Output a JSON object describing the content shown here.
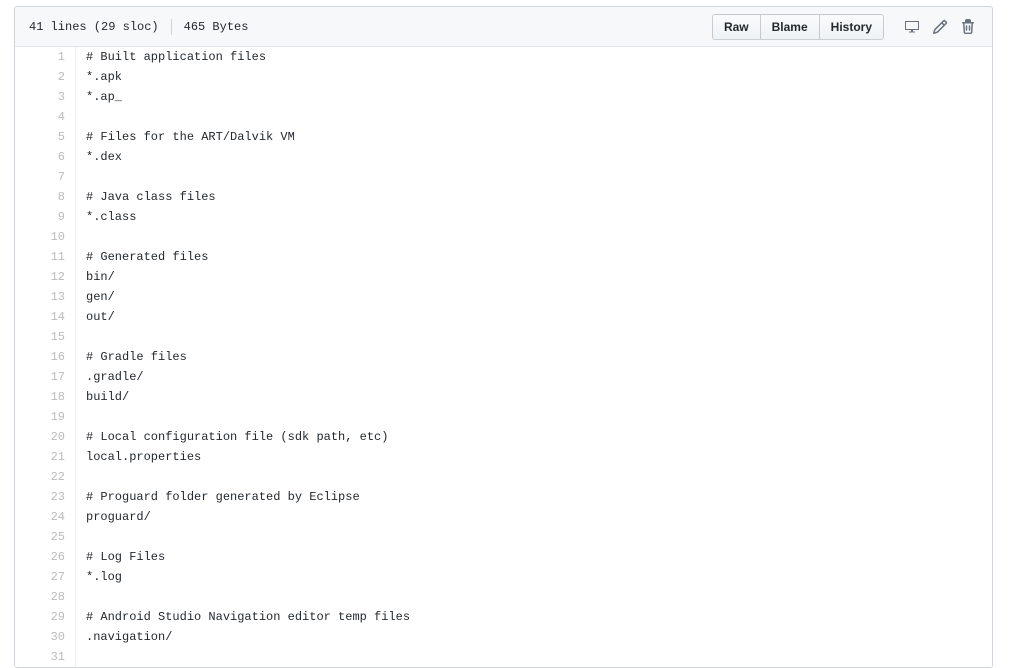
{
  "header": {
    "lines_label": "41 lines (29 sloc)",
    "size_label": "465 Bytes",
    "buttons": [
      {
        "label": "Raw",
        "name": "raw-button"
      },
      {
        "label": "Blame",
        "name": "blame-button"
      },
      {
        "label": "History",
        "name": "history-button"
      }
    ],
    "icons": [
      {
        "name": "desktop-icon",
        "title": "Open this file in GitHub Desktop"
      },
      {
        "name": "pencil-icon",
        "title": "Edit this file"
      },
      {
        "name": "trash-icon",
        "title": "Delete this file"
      }
    ]
  },
  "code": {
    "lines": [
      {
        "num": "1",
        "text": "# Built application files"
      },
      {
        "num": "2",
        "text": "*.apk"
      },
      {
        "num": "3",
        "text": "*.ap_"
      },
      {
        "num": "4",
        "text": ""
      },
      {
        "num": "5",
        "text": "# Files for the ART/Dalvik VM"
      },
      {
        "num": "6",
        "text": "*.dex"
      },
      {
        "num": "7",
        "text": ""
      },
      {
        "num": "8",
        "text": "# Java class files"
      },
      {
        "num": "9",
        "text": "*.class"
      },
      {
        "num": "10",
        "text": ""
      },
      {
        "num": "11",
        "text": "# Generated files"
      },
      {
        "num": "12",
        "text": "bin/"
      },
      {
        "num": "13",
        "text": "gen/"
      },
      {
        "num": "14",
        "text": "out/"
      },
      {
        "num": "15",
        "text": ""
      },
      {
        "num": "16",
        "text": "# Gradle files"
      },
      {
        "num": "17",
        "text": ".gradle/"
      },
      {
        "num": "18",
        "text": "build/"
      },
      {
        "num": "19",
        "text": ""
      },
      {
        "num": "20",
        "text": "# Local configuration file (sdk path, etc)"
      },
      {
        "num": "21",
        "text": "local.properties"
      },
      {
        "num": "22",
        "text": ""
      },
      {
        "num": "23",
        "text": "# Proguard folder generated by Eclipse"
      },
      {
        "num": "24",
        "text": "proguard/"
      },
      {
        "num": "25",
        "text": ""
      },
      {
        "num": "26",
        "text": "# Log Files"
      },
      {
        "num": "27",
        "text": "*.log"
      },
      {
        "num": "28",
        "text": ""
      },
      {
        "num": "29",
        "text": "# Android Studio Navigation editor temp files"
      },
      {
        "num": "30",
        "text": ".navigation/"
      },
      {
        "num": "31",
        "text": ""
      }
    ]
  },
  "colors": {
    "header_bg": "#f6f8fa",
    "border": "#d1d5da",
    "code_text": "#24292e",
    "line_number": "#babbbc",
    "icon": "#6a737d"
  }
}
